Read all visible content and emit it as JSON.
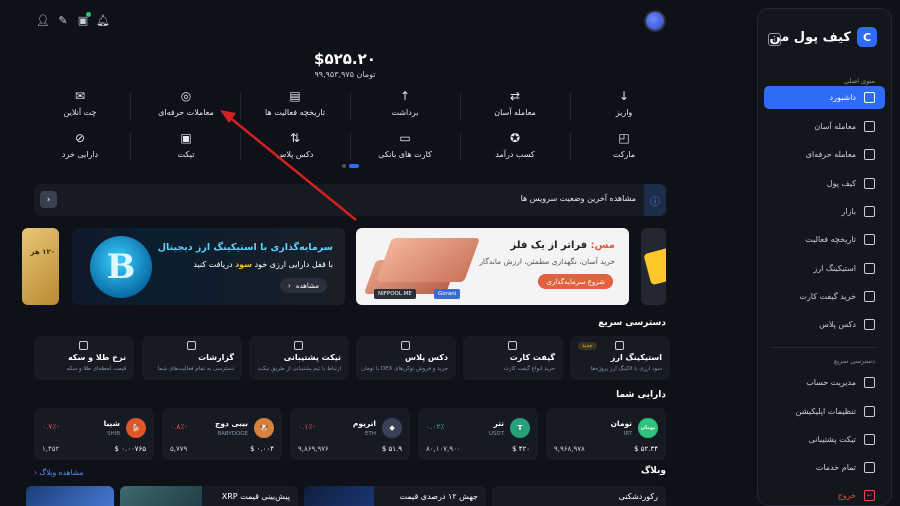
{
  "sidebar": {
    "brand": "کیف پول من",
    "main_menu_heading": "منوی اصلی",
    "items": [
      {
        "label": "داشبورد",
        "icon": "grid-icon",
        "active": true
      },
      {
        "label": "معامله آسان",
        "icon": "swap-icon"
      },
      {
        "label": "معامله حرفه‌ای",
        "icon": "pro-trade-icon"
      },
      {
        "label": "کیف پول",
        "icon": "wallet-icon"
      },
      {
        "label": "بازار",
        "icon": "market-icon"
      },
      {
        "label": "تاریخچه فعالیت",
        "icon": "history-icon"
      },
      {
        "label": "استیکینگ ارز",
        "icon": "staking-icon"
      },
      {
        "label": "خرید گیفت کارت",
        "icon": "gift-card-icon"
      },
      {
        "label": "دکس پلاس",
        "icon": "dex-icon"
      }
    ],
    "quick_heading": "دسترسی سریع",
    "quick_items": [
      {
        "label": "مدیریت حساب",
        "icon": "account-icon"
      },
      {
        "label": "تنظیمات اپلیکیشن",
        "icon": "settings-icon"
      },
      {
        "label": "تیکت پشتیبانی",
        "icon": "ticket-icon"
      },
      {
        "label": "تمام خدمات",
        "icon": "all-services-icon"
      }
    ],
    "logout": "خروج"
  },
  "balance": {
    "usd": "$۵۲۵.۲۰",
    "toman": "۹۹,۹۵۳,۹۷۵",
    "toman_unit": "تومان"
  },
  "actions_row1": [
    {
      "label": "واریز",
      "glyph": "↓"
    },
    {
      "label": "معامله آسان",
      "glyph": "⇄"
    },
    {
      "label": "برداشت",
      "glyph": "↑"
    },
    {
      "label": "تاریخچه فعالیت ها",
      "glyph": "▤"
    },
    {
      "label": "معاملات حرفه‌ای",
      "glyph": "◎"
    },
    {
      "label": "چت آنلاین",
      "glyph": "✉"
    }
  ],
  "actions_row2": [
    {
      "label": "مارکت",
      "glyph": "◰"
    },
    {
      "label": "کسب درآمد",
      "glyph": "✪"
    },
    {
      "label": "کارت های بانکی",
      "glyph": "▭"
    },
    {
      "label": "دکس پلاس",
      "glyph": "⇅"
    },
    {
      "label": "تیکت",
      "glyph": "▣"
    },
    {
      "label": "دارایی خرد",
      "glyph": "⊘"
    }
  ],
  "status_bar": {
    "text": "مشاهده آخرین وضعیت سرویس ها"
  },
  "banners": {
    "metal": {
      "title_accent": "مس:",
      "title": " فراتر از یک فلز",
      "subtitle": "خرید آسان، نگهداری مطمئن، ارزش ماندگار",
      "button": "شروع سرمایه‌گذاری",
      "tag1": "NIFPOOL.ME",
      "tag2": "Gorani"
    },
    "bitcoin": {
      "title": "سرمایه‌گذاری با استیکینگ ارز دیجیتال",
      "subtitle_pre": "با قفل دارایی ارزی خود ",
      "subtitle_accent": "سود",
      "subtitle_post": " دریافت کنید",
      "button": "مشاهده"
    },
    "gold_fragment": "۱۲۰ هز"
  },
  "quick_access": {
    "title": "دسترسی سریع",
    "items": [
      {
        "name": "استیکینگ ارز",
        "desc": "سود ارزی با لاکینگ ارز پروژه‌ها",
        "badge": "جدید"
      },
      {
        "name": "گیفت کارت",
        "desc": "خرید انواع گیفت کارت",
        "badge": ""
      },
      {
        "name": "دکس پلاس",
        "desc": "خرید و فروش توکن‌های DEX با تومان",
        "badge": ""
      },
      {
        "name": "تیکت پشتیبانی",
        "desc": "ارتباط با تیم پشتیبانی از طریق تیکت",
        "badge": ""
      },
      {
        "name": "گزارشات",
        "desc": "دسترسی به تمام فعالیت‌های شما",
        "badge": ""
      },
      {
        "name": "نرخ طلا و سکه",
        "desc": "قیمت لحظه‌ای طلا و سکه",
        "badge": ""
      }
    ]
  },
  "assets": {
    "title": "دارایی شما",
    "items": [
      {
        "name": "تومان",
        "symbol": "IRT",
        "logo_text": "تومان",
        "logo_color": "#2ec27e",
        "change": "",
        "direction": "",
        "value": "$ ۵۲.۳۴",
        "amount": "۹,۹۶۸,۹۷۸"
      },
      {
        "name": "تتر",
        "symbol": "USDT",
        "logo_text": "T",
        "logo_color": "#26a17b",
        "change": "۰.۰۲٪",
        "direction": "up",
        "value": "$ ۴۲۰",
        "amount": "۸۰,۱۰۷,۹۰۰"
      },
      {
        "name": "اتریوم",
        "symbol": "ETH",
        "logo_text": "◆",
        "logo_color": "#3a4158",
        "change": "۰.۱٪-",
        "direction": "down",
        "value": "$ ۵۱.۹",
        "amount": "۹,۸۶۹,۹۷۶"
      },
      {
        "name": "بیبی دوج",
        "symbol": "BABYDOGE",
        "logo_text": "🐶",
        "logo_color": "#d9823b",
        "change": "۰.۸٪-",
        "direction": "down",
        "value": "$ ۰.۰۰۴",
        "amount": "۵,۷۷۹"
      },
      {
        "name": "شیبا",
        "symbol": "SHIB",
        "logo_text": "🐕",
        "logo_color": "#e0552a",
        "change": "۰.۷٪-",
        "direction": "down",
        "value": "$ ۰.۰۰۷۶۵",
        "amount": "۱,۴۵۲"
      }
    ]
  },
  "weblog": {
    "title": "وبلاگ",
    "link": "مشاهده وبلاگ",
    "posts": [
      "رکوردشکنی",
      "جهش ۱۲ درصدی قیمت",
      "پیش‌بینی قیمت XRP"
    ]
  },
  "colors": {
    "accent": "#2f6cf6",
    "positive": "#2ec27e",
    "negative": "#f04a4a",
    "background": "#0e1117"
  }
}
